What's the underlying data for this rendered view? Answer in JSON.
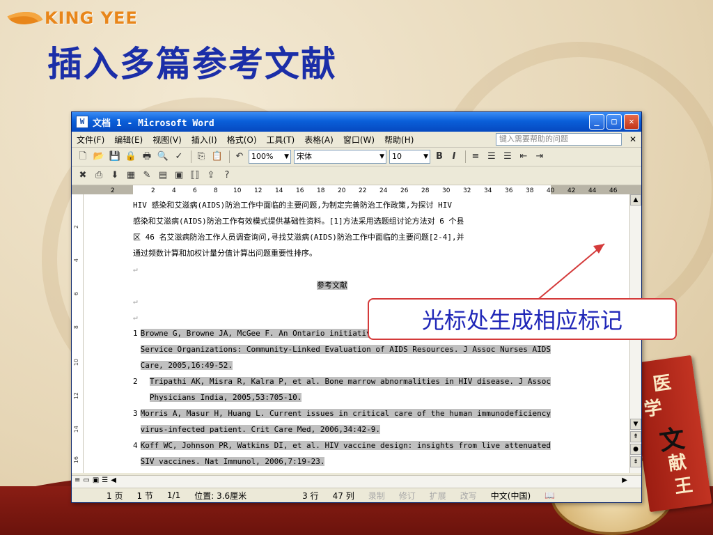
{
  "brand": "KING YEE",
  "slide_title": "插入多篇参考文献",
  "book_chars": [
    "医",
    "学",
    "文",
    "献",
    "王"
  ],
  "window": {
    "title": "文档 1 - Microsoft Word",
    "icon_label": "W"
  },
  "menu": [
    "文件(F)",
    "编辑(E)",
    "视图(V)",
    "插入(I)",
    "格式(O)",
    "工具(T)",
    "表格(A)",
    "窗口(W)",
    "帮助(H)"
  ],
  "help_placeholder": "键入需要帮助的问题",
  "toolbar": {
    "zoom": "100%",
    "font": "宋体",
    "size": "10"
  },
  "ruler_ticks": [
    "2",
    "2",
    "4",
    "6",
    "8",
    "10",
    "12",
    "14",
    "16",
    "18",
    "20",
    "22",
    "24",
    "26",
    "28",
    "30",
    "32",
    "34",
    "36",
    "38",
    "40",
    "42",
    "44",
    "46"
  ],
  "vruler": [
    "2",
    "4",
    "6",
    "8",
    "10",
    "12",
    "14",
    "16"
  ],
  "body": {
    "lines": [
      "HIV 感染和艾滋病(AIDS)防治工作中面临的主要问题,为制定完善防治工作政策,为探讨 HIV",
      "感染和艾滋病(AIDS)防治工作有效模式提供基础性资料。[1]方法采用选题组讨论方法对 6 个县",
      "区 46 名艾滋病防治工作人员调查询问,寻找艾滋病(AIDS)防治工作中面临的主要问题[2-4],并",
      "通过频数计算和加权计量分值计算出问题重要性排序。"
    ],
    "heading": "参考文献"
  },
  "references": [
    {
      "num": "1",
      "lines": [
        "Browne G, Browne JA, McGee F. An Ontario initiative to enhance the effectiveness of AIDS",
        "Service Organizations: Community-Linked Evaluation of AIDS Resources. J Assoc Nurses AIDS",
        "Care, 2005,16:49-52."
      ]
    },
    {
      "num": "2",
      "lines": [
        "Tripathi AK, Misra R, Kalra P, et al. Bone marrow abnormalities in HIV disease. J Assoc",
        "Physicians India, 2005,53:705-10."
      ]
    },
    {
      "num": "3",
      "lines": [
        "Morris A, Masur H, Huang L. Current issues in critical care of the human immunodeficiency",
        "virus-infected patient. Crit Care Med, 2006,34:42-9."
      ]
    },
    {
      "num": "4",
      "lines": [
        "Koff WC, Johnson PR, Watkins DI, et al. HIV vaccine design: insights from live attenuated",
        "SIV vaccines. Nat Immunol, 2006,7:19-23."
      ]
    }
  ],
  "callout": "光标处生成相应标记",
  "status": {
    "page": "1 页",
    "section": "1 节",
    "pages": "1/1",
    "position": "位置: 3.6厘米",
    "line": "3 行",
    "col": "47 列",
    "rec": "录制",
    "trk": "修订",
    "ext": "扩展",
    "ovr": "改写",
    "lang": "中文(中国)"
  }
}
